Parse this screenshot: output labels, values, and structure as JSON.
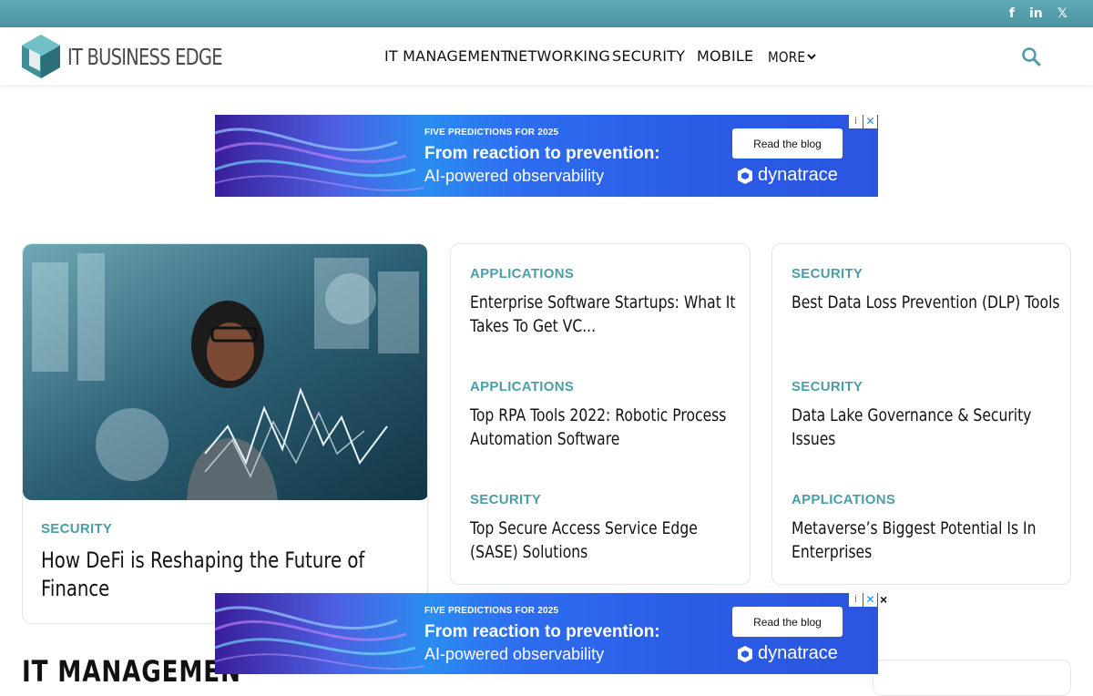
{
  "social": {
    "facebook": "f",
    "linkedin": "in",
    "x": "𝕏"
  },
  "brand": {
    "name": "IT BUSINESS EDGE",
    "accent": "#4b9da7"
  },
  "nav": {
    "items": [
      "IT MANAGEMENT",
      "NETWORKING",
      "SECURITY",
      "MOBILE",
      "MORE"
    ],
    "more_icon": "chevron-down-icon",
    "search_icon": "search-icon"
  },
  "ads": [
    {
      "kicker": "FIVE PREDICTIONS FOR 2025",
      "headline": "From reaction to prevention:",
      "sub": "AI-powered observability",
      "button": "Read the blog",
      "brand": "dynatrace"
    },
    {
      "kicker": "FIVE PREDICTIONS FOR 2025",
      "headline": "From reaction to prevention:",
      "sub": "AI-powered observability",
      "button": "Read the blog",
      "brand": "dynatrace"
    }
  ],
  "featured": {
    "category": "SECURITY",
    "title": "How DeFi is Reshaping the Future of Finance"
  },
  "column1": [
    {
      "category": "APPLICATIONS",
      "title": "Enterprise Software Startups: What It Takes To Get VC..."
    },
    {
      "category": "APPLICATIONS",
      "title": "Top RPA Tools 2022: Robotic Process Automation Software"
    },
    {
      "category": "SECURITY",
      "title": "Top Secure Access Service Edge (SASE) Solutions"
    }
  ],
  "column2": [
    {
      "category": "SECURITY",
      "title": "Best Data Loss Prevention (DLP) Tools"
    },
    {
      "category": "SECURITY",
      "title": "Data Lake Governance & Security Issues"
    },
    {
      "category": "APPLICATIONS",
      "title": "Metaverse’s Biggest Potential Is In Enterprises"
    }
  ],
  "close_label": "×",
  "section_heading": "IT MANAGEMEN"
}
